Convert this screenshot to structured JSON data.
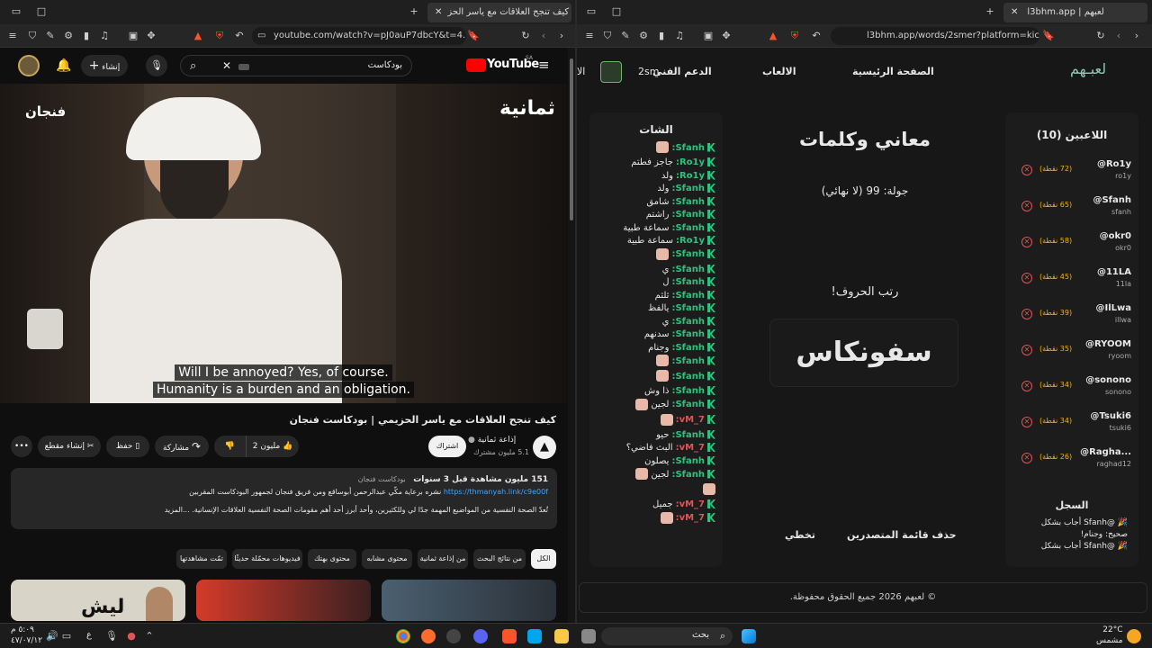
{
  "left": {
    "tab_title": "كيف تنجح العلاقات مع ياسر الحز",
    "url": "youtube.com/watch?v=pJ0auP7dbcY&t=4...",
    "yt_logo": "YouTube",
    "yt_region": "SA",
    "search_value": "بودكاست",
    "create_label": "إنشاء",
    "video_badge_right": "ثمانية",
    "video_badge_left": "فنجان",
    "subtitle_line1": "Will I be annoyed? Yes, of course.",
    "subtitle_line2": "Humanity is a burden and an obligation.",
    "video_title": "كيف تنجح العلاقات مع ياسر الحزيمي | بودكاست فنجان",
    "channel_name": "إذاعة ثمانية",
    "channel_subs": "5.1 مليون مشترك",
    "subscribe_label": "اشتراك",
    "like_count": "2 مليون",
    "share_label": "مشاركة",
    "save_label": "حفظ",
    "clip_label": "إنشاء مقطع",
    "desc_stats": "151 مليون مشاهدة  قبل 3 سنوات",
    "desc_tags": "بودكاست فنجان",
    "desc_line2_text": "نشره برعاية مكّي عبدالرحمن أبوساقع ومن فريق فنجان لجمهور البودكاست المقربين",
    "desc_link": "https://thmanyah.link/c9e00f",
    "desc_line3": "تُعدّ الصحة النفسية من المواضيع المهمة جدًا لي وللكثيرين، وأحد أبرز أحد أهم مقومات الصحة النفسية العلاقات الإنسانية. ...المزيد",
    "chips": [
      "الكل",
      "من نتائج البحث",
      "من إذاعة ثمانية",
      "محتوى مشابه",
      "محتوى بهتك",
      "فيديوهات محمّلة حديثًا",
      "تمّت مشاهدتها"
    ],
    "thumb_text": "ليش"
  },
  "right": {
    "tab_title": "l3bhm.app | لعبهم",
    "url": "l3bhm.app/words/2smer?platform=kick",
    "logo": "لعبـهم",
    "nav_home": "الصفحة الرئيسية",
    "nav_games": "الالعاب",
    "nav_support": "الدعم الفني",
    "user_short": "2sm",
    "nav_cut": "الا",
    "players_title": "اللاعبين (10)",
    "players": [
      {
        "name": "@Ro1y",
        "handle": "ro1y",
        "points": "(72 نقطة)"
      },
      {
        "name": "@Sfanh",
        "handle": "sfanh",
        "points": "(65 نقطة)"
      },
      {
        "name": "@okr0",
        "handle": "okr0",
        "points": "(58 نقطة)"
      },
      {
        "name": "@11LA",
        "handle": "11la",
        "points": "(45 نقطة)"
      },
      {
        "name": "@IlLwa",
        "handle": "illwa",
        "points": "(39 نقطة)"
      },
      {
        "name": "@RYOOM",
        "handle": "ryoom",
        "points": "(35 نقطة)"
      },
      {
        "name": "@sonono",
        "handle": "sonono",
        "points": "(34 نقطة)"
      },
      {
        "name": "@Tsuki6",
        "handle": "tsuki6",
        "points": "(34 نقطة)"
      },
      {
        "name": "@Ragha...",
        "handle": "raghad12",
        "points": "(26 نقطة)"
      }
    ],
    "log_title": "السجل",
    "log": [
      "@Sfanh أجاب بشكل",
      "صحيح: وجنام!",
      "@Sfanh أجاب بشكل"
    ],
    "game_title": "معاني وكلمات",
    "round": "جولة: 99 (لا نهائي)",
    "prompt": "رتب الحروف!",
    "scrambled": "سفونكاس",
    "clear_board": "حذف قائمة المتصدرين",
    "skip": "تخطي",
    "chat_title": "الشات",
    "chat": [
      {
        "user": "Sfanh:",
        "msg": "",
        "emoji": true,
        "cls": "g"
      },
      {
        "user": "Ro1y:",
        "msg": "جاجز فطتم",
        "emoji": false,
        "cls": "g"
      },
      {
        "user": "Ro1y:",
        "msg": "ولد",
        "emoji": false,
        "cls": "g"
      },
      {
        "user": "Sfanh:",
        "msg": "ولد",
        "emoji": false,
        "cls": "g"
      },
      {
        "user": "Sfanh:",
        "msg": "شامق",
        "emoji": false,
        "cls": "g"
      },
      {
        "user": "Sfanh:",
        "msg": "راشتم",
        "emoji": false,
        "cls": "g"
      },
      {
        "user": "Sfanh:",
        "msg": "سماعة طبية",
        "emoji": false,
        "cls": "g"
      },
      {
        "user": "Ro1y:",
        "msg": "سماعة طبية",
        "emoji": false,
        "cls": "g"
      },
      {
        "user": "Sfanh:",
        "msg": "",
        "emoji": true,
        "cls": "g"
      },
      {
        "user": "Sfanh:",
        "msg": "ي",
        "emoji": false,
        "cls": "g"
      },
      {
        "user": "Sfanh:",
        "msg": "ل",
        "emoji": false,
        "cls": "g"
      },
      {
        "user": "Sfanh:",
        "msg": "ثلثم",
        "emoji": false,
        "cls": "g"
      },
      {
        "user": "Sfanh:",
        "msg": "يالفظ",
        "emoji": false,
        "cls": "g"
      },
      {
        "user": "Sfanh:",
        "msg": "ي",
        "emoji": false,
        "cls": "g"
      },
      {
        "user": "Sfanh:",
        "msg": "سدنهم",
        "emoji": false,
        "cls": "g"
      },
      {
        "user": "Sfanh:",
        "msg": "وجنام",
        "emoji": false,
        "cls": "g"
      },
      {
        "user": "Sfanh:",
        "msg": "",
        "emoji": true,
        "cls": "g"
      },
      {
        "user": "Sfanh:",
        "msg": "",
        "emoji": true,
        "cls": "g"
      },
      {
        "user": "Sfanh:",
        "msg": "ذا وش",
        "emoji": false,
        "cls": "g"
      },
      {
        "user": "Sfanh:",
        "msg": "لجين",
        "emoji": true,
        "cls": "g"
      },
      {
        "user": "vM_7:",
        "msg": "",
        "emoji": true,
        "cls": "r"
      },
      {
        "user": "Sfanh:",
        "msg": "حيو",
        "emoji": false,
        "cls": "g"
      },
      {
        "user": "vM_7:",
        "msg": "البث فاضي؟",
        "emoji": false,
        "cls": "r"
      },
      {
        "user": "Sfanh:",
        "msg": "يصلون",
        "emoji": false,
        "cls": "g"
      },
      {
        "user": "Sfanh:",
        "msg": "لجين",
        "emoji": true,
        "cls": "g"
      },
      {
        "user": "",
        "msg": "",
        "emoji": true,
        "cls": "g"
      },
      {
        "user": "vM_7:",
        "msg": "جميل",
        "emoji": false,
        "cls": "r"
      },
      {
        "user": "vM_7:",
        "msg": "",
        "emoji": true,
        "cls": "r"
      }
    ],
    "footer": "© لعبهم 2026 جميع الحقوق محفوظة."
  },
  "taskbar": {
    "search": "بحث",
    "weather_temp": "22°C",
    "weather_desc": "مشمس",
    "time": "٥:٠٩ م",
    "date": "٤٧/٠٧/١٢",
    "lang": "ع"
  },
  "colors": {
    "accent_green": "#2ec27e",
    "chat_red": "#e05555",
    "yt_red": "#ff0000"
  }
}
